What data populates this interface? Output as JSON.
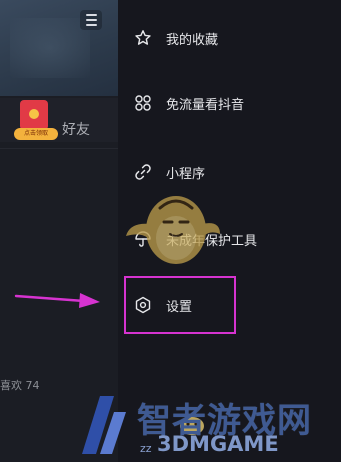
{
  "left_pane": {
    "friend_label": "好友",
    "red_packet_tag": "点击领取",
    "likes_text": "喜欢 74"
  },
  "drawer": {
    "items": [
      {
        "label": "我的收藏",
        "icon": "star-icon"
      },
      {
        "label": "免流量看抖音",
        "icon": "grid-icon"
      },
      {
        "label": "小程序",
        "icon": "link-icon"
      },
      {
        "label": "未成年保护工具",
        "icon": "umbrella-icon"
      },
      {
        "label": "设置",
        "icon": "gear-icon"
      }
    ]
  },
  "annotation": {
    "highlight_color": "#d633d0",
    "arrow_color": "#d633d0"
  },
  "watermark": {
    "cn_text": "智者游戏网",
    "en_text": "3DMGAME",
    "en_prefix": "zz"
  }
}
